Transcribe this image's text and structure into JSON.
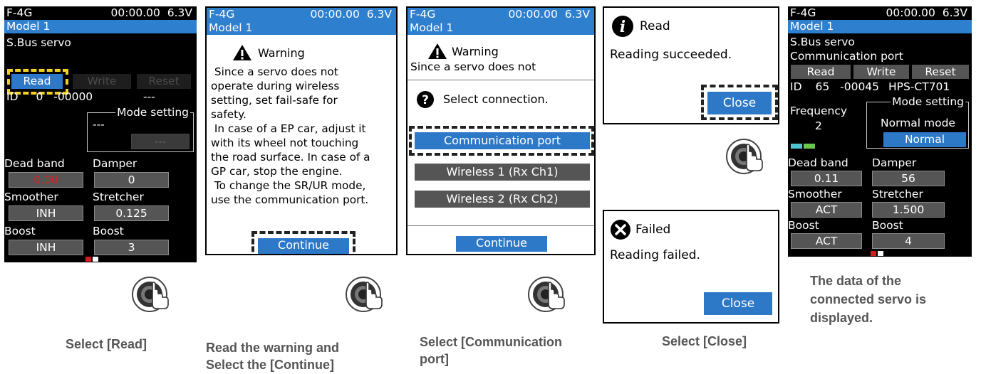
{
  "status": {
    "model": "F-4G",
    "timer": "00:00.00",
    "voltage": "6.3V"
  },
  "model_name": "Model 1",
  "screen1": {
    "heading": "S.Bus servo",
    "buttons": {
      "read": "Read",
      "write": "Write",
      "reset": "Reset"
    },
    "id_label": "ID",
    "id_value": "0",
    "id_dash": "-",
    "serial": "00000",
    "servo_type": "---",
    "mode_setting_label": "Mode setting",
    "mode_value": "---",
    "mode_button": "---",
    "fields": {
      "dead_band_label": "Dead band",
      "dead_band": "0.00",
      "damper_label": "Damper",
      "damper": "0",
      "smoother_label": "Smoother",
      "smoother": "INH",
      "stretcher_label": "Stretcher",
      "stretcher": "0.125",
      "boost_label": "Boost",
      "boost": "INH",
      "boost2_label": "Boost",
      "boost2": "3"
    }
  },
  "screen2": {
    "warning_title": "Warning",
    "body": " Since a servo does not\noperate during wireless\nsetting, set fail-safe for\nsafety.\n In case of a EP car, adjust it\nwith its wheel not touching\nthe road surface. In case of a\nGP car, stop the engine.\n To change the SR/UR mode,\nuse the communication port.",
    "continue": "Continue"
  },
  "screen3": {
    "warning_title": "Warning",
    "body_partial": "Since a servo does not",
    "select_title": "Select connection.",
    "options": [
      "Communication port",
      "Wireless 1 (Rx Ch1)",
      "Wireless 2 (Rx Ch2)"
    ],
    "continue": "Continue"
  },
  "dialog_read": {
    "title": "Read",
    "message": "Reading succeeded.",
    "close": "Close"
  },
  "dialog_failed": {
    "title": "Failed",
    "message": "Reading failed.",
    "close": "Close"
  },
  "screen5": {
    "heading": "S.Bus servo",
    "subheading": "Communication port",
    "buttons": {
      "read": "Read",
      "write": "Write",
      "reset": "Reset"
    },
    "id_label": "ID",
    "id_value": "65",
    "id_dash": "-",
    "serial": "00045",
    "servo_type": "HPS-CT701",
    "frequency_label": "Frequency",
    "frequency": "2",
    "mode_setting_label": "Mode setting",
    "mode_value": "Normal mode",
    "mode_button": "Normal",
    "fields": {
      "dead_band_label": "Dead band",
      "dead_band": "0.11",
      "damper_label": "Damper",
      "damper": "56",
      "smoother_label": "Smoother",
      "smoother": "ACT",
      "stretcher_label": "Stretcher",
      "stretcher": "1.500",
      "boost_label": "Boost",
      "boost": "ACT",
      "boost2_label": "Boost",
      "boost2": "4"
    }
  },
  "captions": {
    "step1": "Select [Read]",
    "step2_line1": "Read the warning and",
    "step2_line2": "Select the [Continue]",
    "step3_line1": "Select  [Communication",
    "step3_line2": "port]",
    "step4": "Select [Close]",
    "step5_line1": "The data of the",
    "step5_line2": "connected servo is",
    "step5_line3": "displayed."
  },
  "colors": {
    "accent_blue": "#2e78c8",
    "highlight_yellow": "#f0d020",
    "value_red": "#e02020"
  },
  "icons": [
    "warning-icon",
    "question-icon",
    "info-icon",
    "error-icon",
    "dial-press-icon"
  ]
}
